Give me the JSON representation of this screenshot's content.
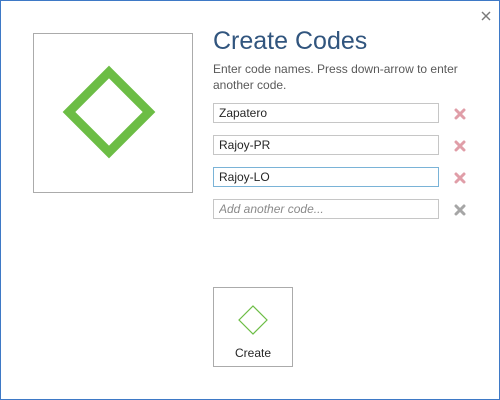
{
  "dialog": {
    "title": "Create Codes",
    "instructions": "Enter code names. Press down-arrow to enter another code.",
    "close_icon": "close-icon",
    "preview_icon": "diamond-icon",
    "codes": [
      {
        "value": "Zapatero",
        "delete_icon": "x-icon"
      },
      {
        "value": "Rajoy-PR",
        "delete_icon": "x-icon"
      },
      {
        "value": "Rajoy-LO",
        "delete_icon": "x-icon"
      }
    ],
    "new_code": {
      "placeholder": "Add another code...",
      "value": ""
    },
    "create_button": {
      "label": "Create",
      "icon": "diamond-icon"
    }
  },
  "colors": {
    "accent_border": "#3e79c6",
    "title": "#31557e",
    "diamond_green": "#6cbd45",
    "delete_active": "#e09ea8",
    "delete_inactive": "#a6a6a6"
  }
}
